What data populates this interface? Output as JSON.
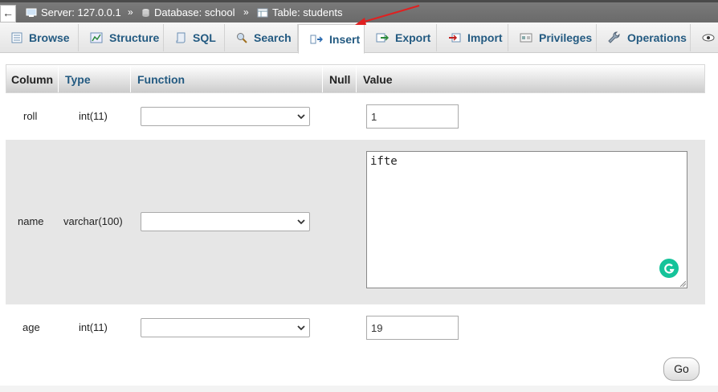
{
  "breadcrumb": {
    "back_label": "←",
    "server": "Server: 127.0.0.1",
    "database": "Database: school",
    "table": "Table: students",
    "separator": "»"
  },
  "tabs": [
    {
      "label": "Browse",
      "icon": "browse-icon",
      "active": false
    },
    {
      "label": "Structure",
      "icon": "structure-icon",
      "active": false
    },
    {
      "label": "SQL",
      "icon": "sql-icon",
      "active": false
    },
    {
      "label": "Search",
      "icon": "search-icon",
      "active": false
    },
    {
      "label": "Insert",
      "icon": "insert-icon",
      "active": true
    },
    {
      "label": "Export",
      "icon": "export-icon",
      "active": false
    },
    {
      "label": "Import",
      "icon": "import-icon",
      "active": false
    },
    {
      "label": "Privileges",
      "icon": "privileges-icon",
      "active": false
    },
    {
      "label": "Operations",
      "icon": "operations-icon",
      "active": false
    }
  ],
  "table_header": {
    "column": "Column",
    "type": "Type",
    "function": "Function",
    "null": "Null",
    "value": "Value"
  },
  "rows": [
    {
      "column": "roll",
      "type": "int(11)",
      "function": "",
      "value": "1"
    },
    {
      "column": "name",
      "type": "varchar(100)",
      "function": "",
      "value": "ifte"
    },
    {
      "column": "age",
      "type": "int(11)",
      "function": "",
      "value": "19"
    }
  ],
  "go_button": "Go",
  "colors": {
    "tab_text": "#235a81",
    "annotation_arrow": "#e02020",
    "grammarly": "#15c39a"
  }
}
